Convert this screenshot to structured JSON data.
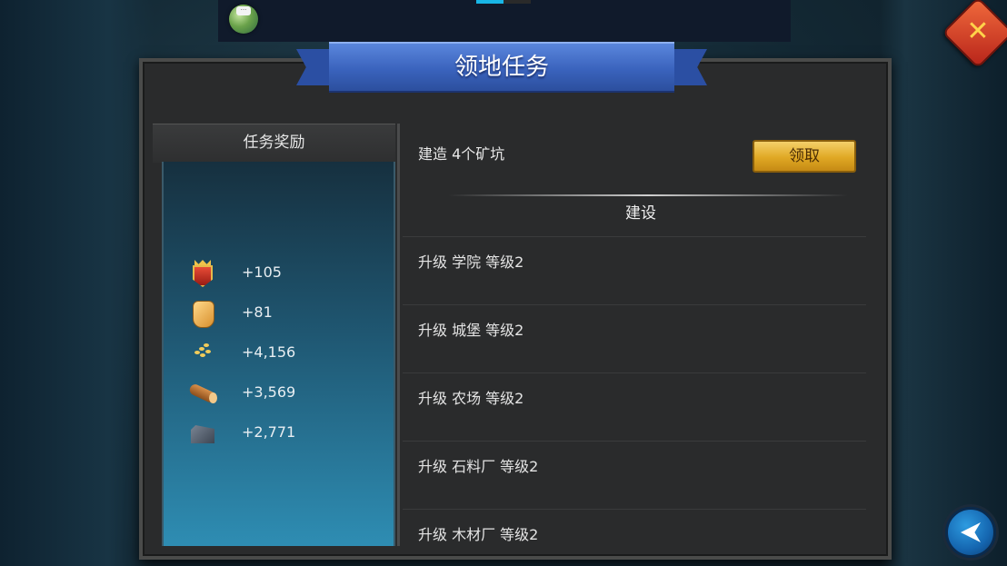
{
  "header": {
    "title": "领地任务"
  },
  "rewards": {
    "heading": "任务奖励",
    "items": [
      {
        "icon": "medal-icon",
        "value": "+105"
      },
      {
        "icon": "fist-icon",
        "value": "+81"
      },
      {
        "icon": "wheat-icon",
        "value": "+4,156"
      },
      {
        "icon": "log-icon",
        "value": "+3,569"
      },
      {
        "icon": "stone-icon",
        "value": "+2,771"
      }
    ]
  },
  "tasks": {
    "current": "建造  4个矿坑",
    "claim_label": "领取",
    "section_title": "建设",
    "list": [
      "升级  学院 等级2",
      "升级  城堡 等级2",
      "升级  农场  等级2",
      "升级  石料厂  等级2",
      "升级  木材厂  等级2"
    ]
  },
  "colors": {
    "banner": "#3a63bd",
    "claim_button": "#e0a824",
    "close_button": "#d9402a",
    "back_button": "#1566b0"
  }
}
